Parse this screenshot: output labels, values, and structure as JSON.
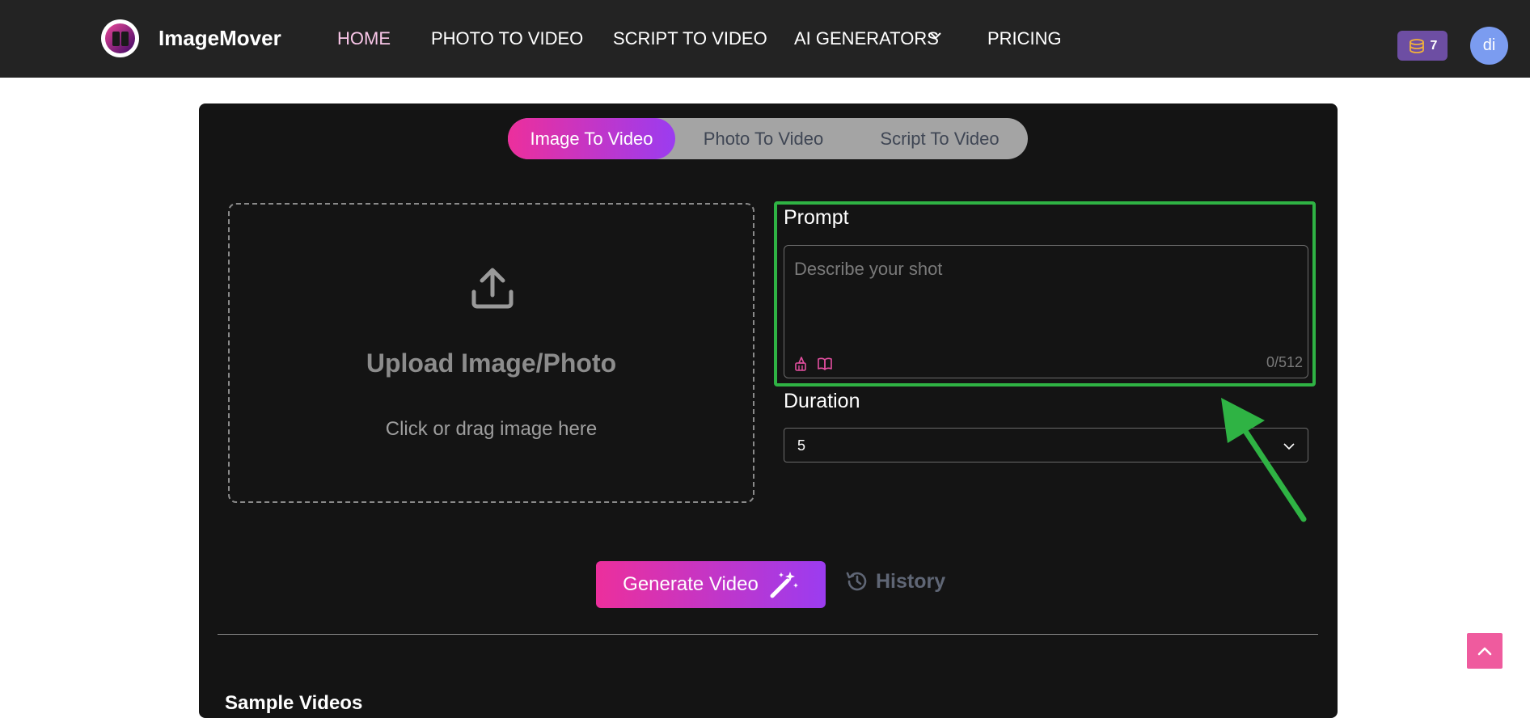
{
  "nav": {
    "brand": "ImageMover",
    "links": [
      "HOME",
      "PHOTO TO VIDEO",
      "SCRIPT TO VIDEO",
      "AI GENERATORS",
      "PRICING"
    ],
    "credits": "7",
    "avatar": "di"
  },
  "tabs": [
    "Image To Video",
    "Photo To Video",
    "Script To Video"
  ],
  "upload": {
    "title": "Upload Image/Photo",
    "subtitle": "Click or drag image here"
  },
  "prompt": {
    "label": "Prompt",
    "placeholder": "Describe your shot",
    "counter": "0/512"
  },
  "duration": {
    "label": "Duration",
    "value": "5"
  },
  "actions": {
    "generate": "Generate Video",
    "history": "History"
  },
  "section": {
    "sample_title": "Sample Videos"
  },
  "colors": {
    "accent_gradient_start": "#ec2f9c",
    "accent_gradient_end": "#9b3cf0",
    "highlight_green": "#2fb344",
    "navbar": "#232323",
    "card": "#141414"
  }
}
